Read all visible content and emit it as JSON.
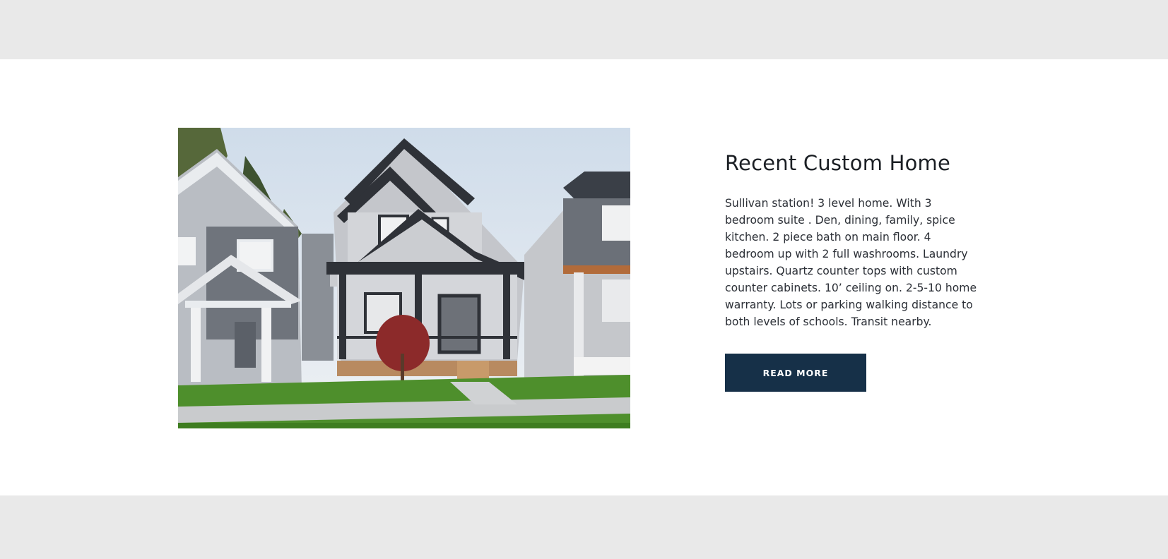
{
  "feature": {
    "title": "Recent Custom Home",
    "description": "Sullivan station! 3 level home. With 3 bedroom suite . Den, dining, family, spice kitchen. 2 piece bath on main floor. 4 bedroom up with 2 full washrooms. Laundry upstairs. Quartz counter tops with custom counter cabinets. 10’ ceiling on. 2-5-10 home warranty. Lots or parking walking distance to both levels of schools. Transit nearby.",
    "button_label": "READ MORE",
    "image_subject": "house-photo"
  },
  "colors": {
    "band": "#e9e9e9",
    "section_bg": "#ffffff",
    "button_bg": "#163048",
    "button_text": "#ffffff",
    "title_text": "#1b1f24",
    "body_text": "#2b2f36"
  }
}
